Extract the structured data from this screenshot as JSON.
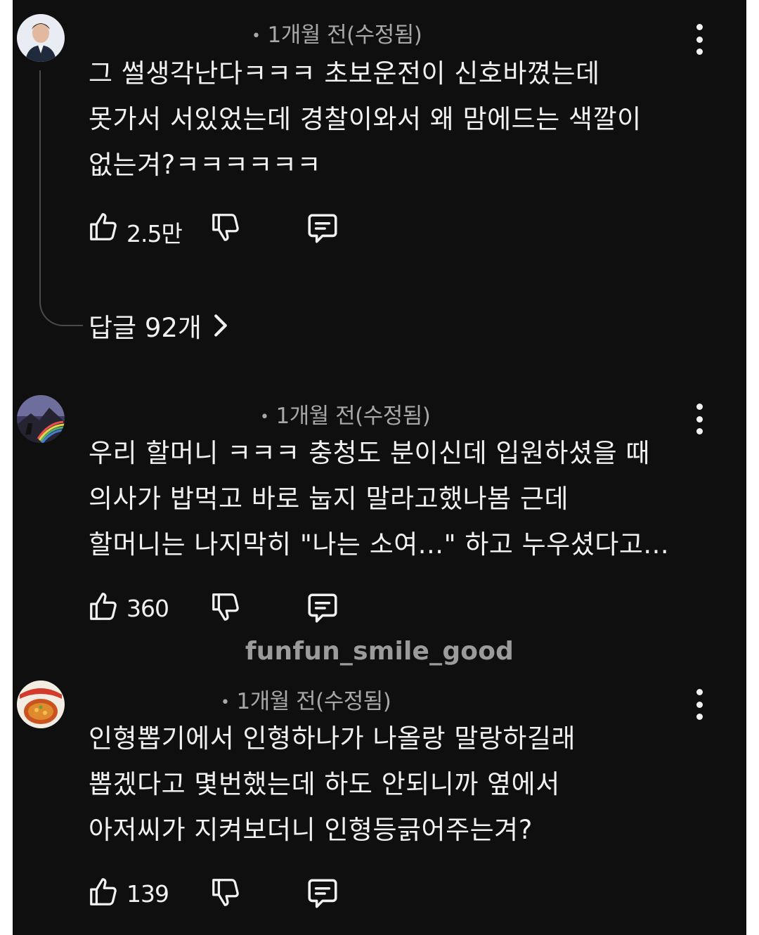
{
  "comments": [
    {
      "timestamp": "1개월 전(수정됨)",
      "lines": [
        "그 썰생각난다ㅋㅋㅋ 초보운전이 신호바꼈는데",
        "못가서 서있었는데 경찰이와서 왜 맘에드는 색깔이",
        "없는겨?ㅋㅋㅋㅋㅋㅋ"
      ],
      "likes": "2.5만",
      "replies_label": "답글 92개"
    },
    {
      "timestamp": "1개월 전(수정됨)",
      "lines": [
        "우리 할머니 ㅋㅋㅋ 충청도 분이신데 입원하셨을 때",
        "의사가 밥먹고 바로 눕지 말라고했나봄 근데",
        "할머니는 나지막히 \"나는 소여...\" 하고 누우셨다고..."
      ],
      "likes": "360"
    },
    {
      "timestamp": "1개월 전(수정됨)",
      "lines": [
        "인형뽑기에서 인형하나가 나올랑 말랑하길래",
        "뽑겠다고 몇번했는데 하도 안되니까 옆에서",
        "아저씨가 지켜보더니 인형등긁어주는겨?"
      ],
      "likes": "139"
    }
  ],
  "watermark": "funfun_smile_good",
  "icons": {
    "like": "thumbs-up-icon",
    "dislike": "thumbs-down-icon",
    "reply": "comment-icon",
    "menu": "more-vert-icon",
    "chevron": "chevron-right-icon"
  },
  "colors": {
    "background": "#0f0f0f",
    "text": "#f1f1f1",
    "meta": "#a8a8a8",
    "watermark": "#9b9b9b"
  }
}
